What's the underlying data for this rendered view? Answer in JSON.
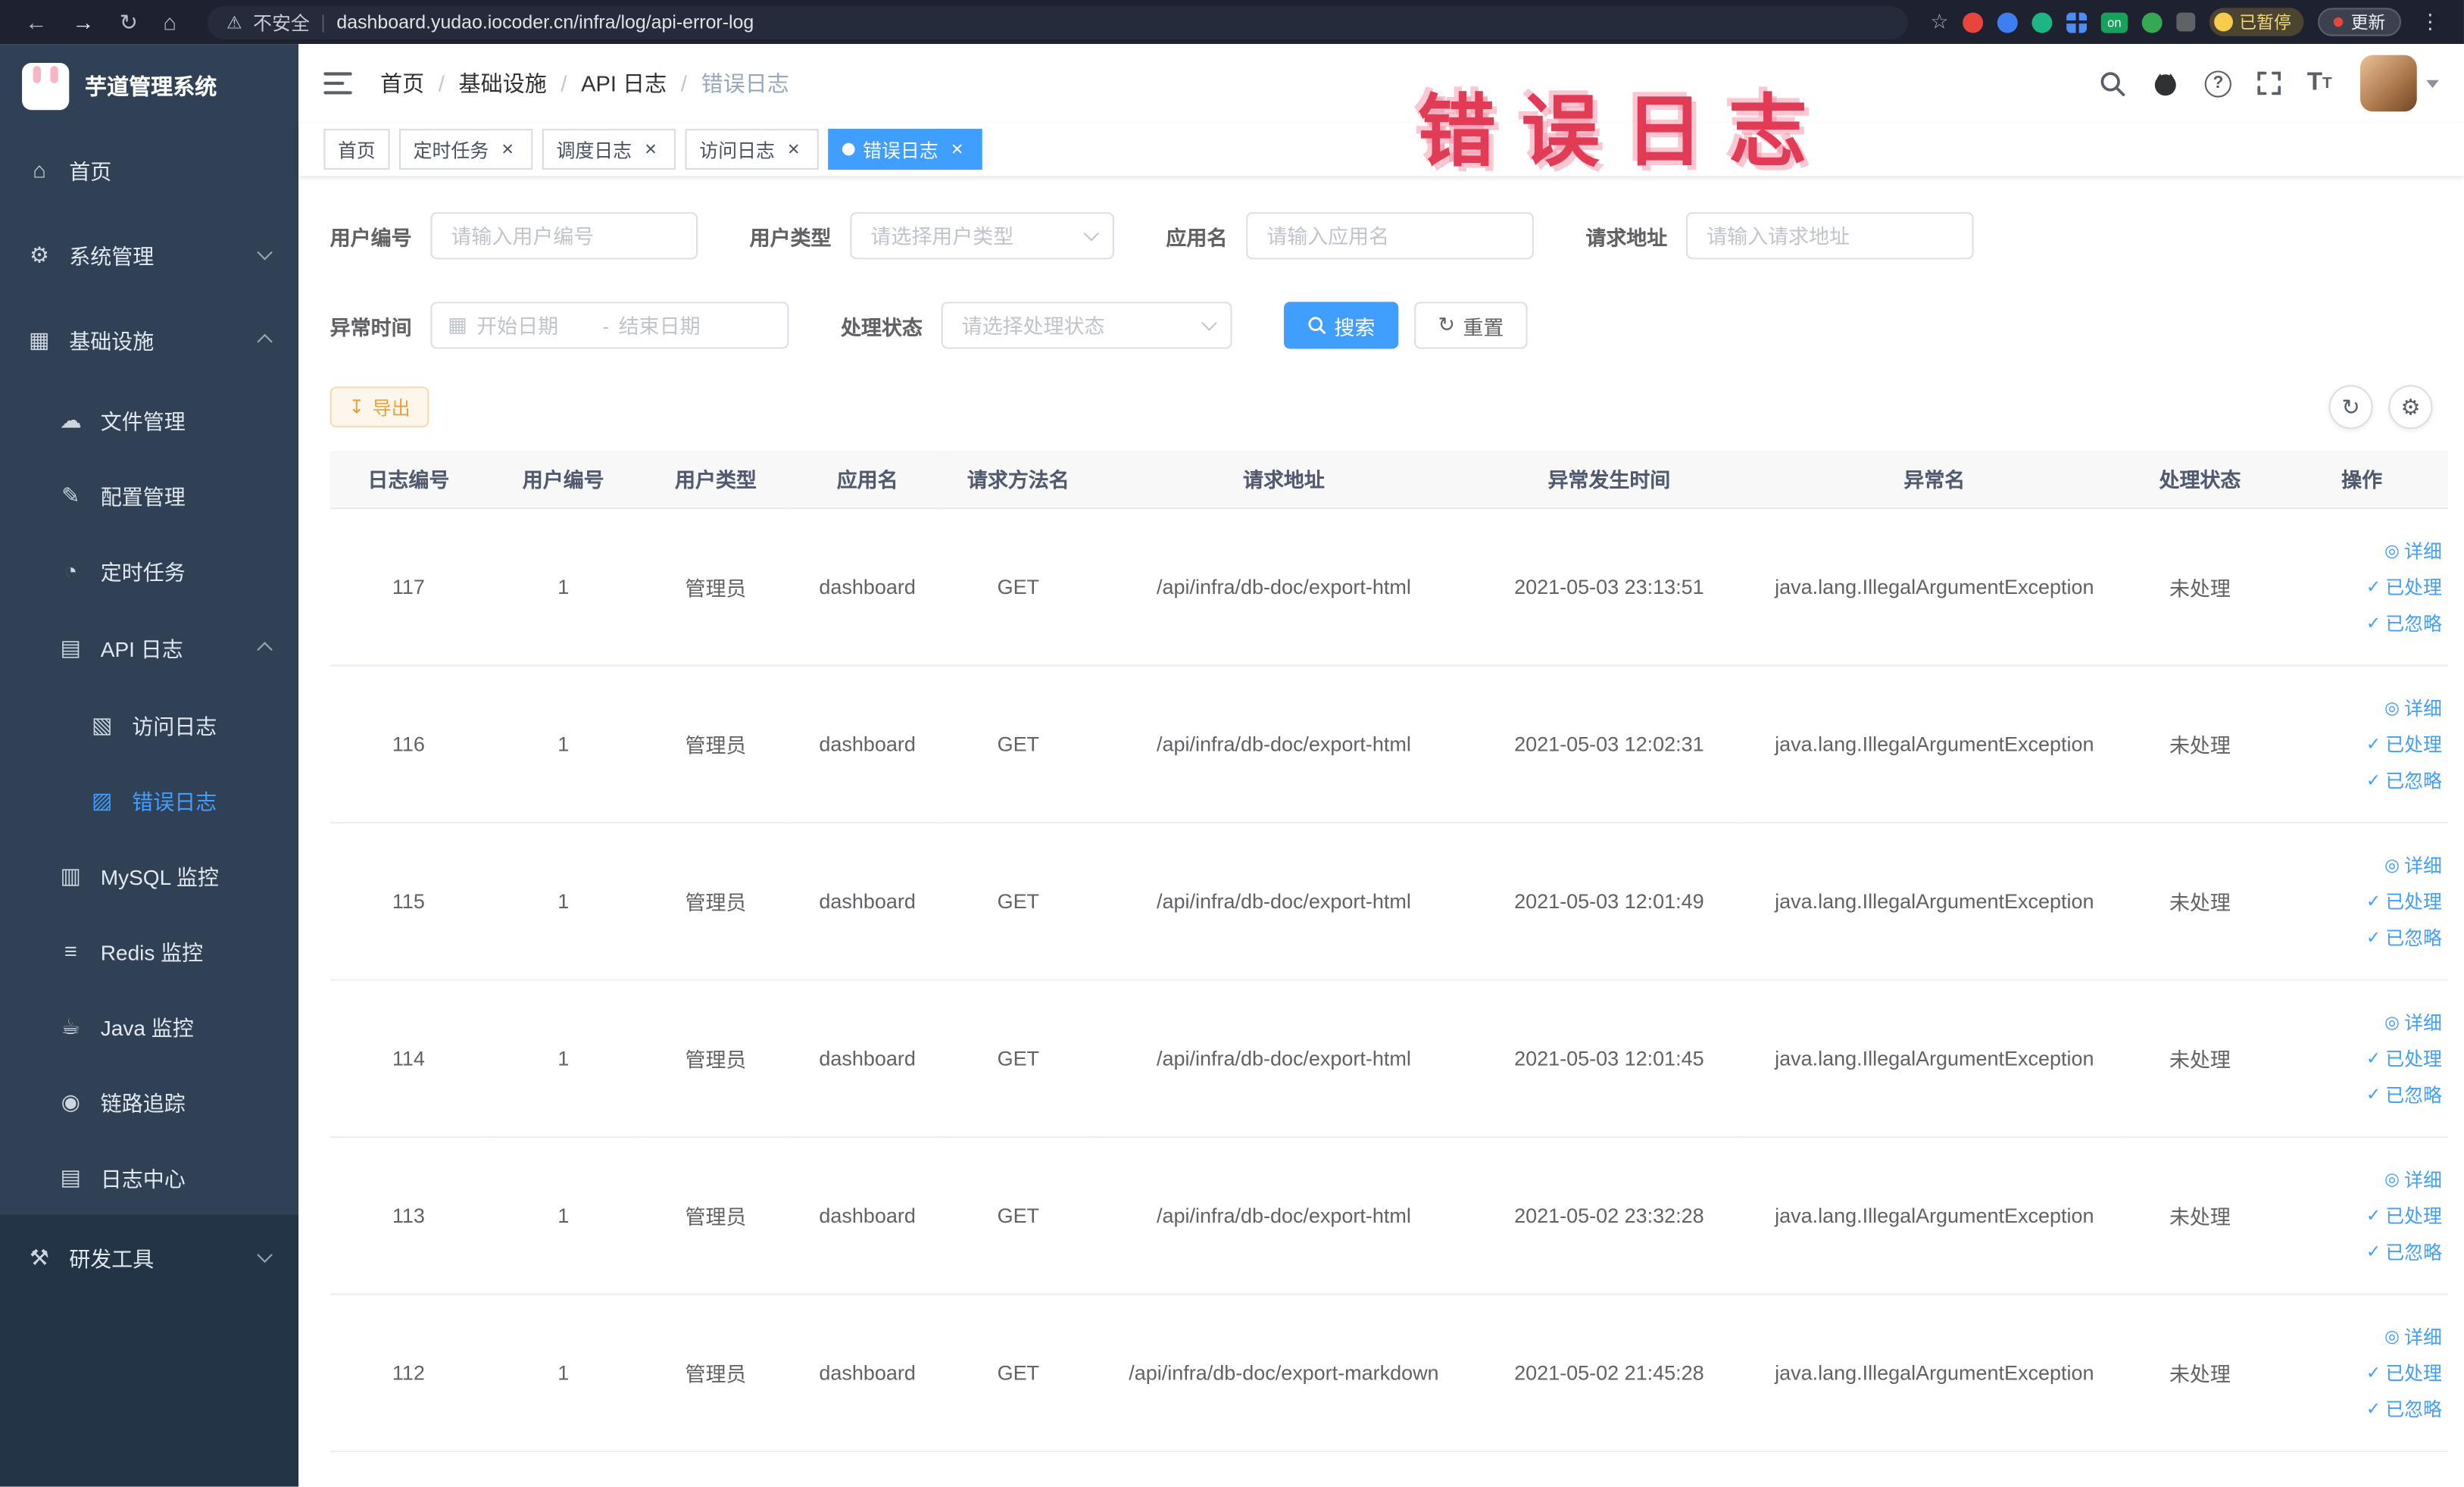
{
  "browser": {
    "security_label": "不安全",
    "url": "dashboard.yudao.iocoder.cn/infra/log/api-error-log",
    "ext_on_label": "on",
    "paused_label": "已暂停",
    "update_label": "更新"
  },
  "icons": {
    "back": "←",
    "forward": "→",
    "reload": "↻",
    "home": "⌂",
    "warning": "⚠",
    "star": "☆",
    "kebab": "⋮",
    "divider": "|",
    "sidebar_home": "⌂",
    "gear": "⚙",
    "infra": "▦",
    "file": "☁",
    "config": "✎",
    "timer": "◔",
    "api_log": "▤",
    "access_log": "▧",
    "error_log": "▨",
    "mysql": "▥",
    "redis": "≡",
    "java": "☕",
    "trace": "◉",
    "log_center": "▤",
    "tools": "⚒",
    "question": "?",
    "calendar": "▦",
    "download": "↧",
    "refresh": "↻",
    "settings": "⚙",
    "eye": "◎",
    "check": "✓",
    "close": "×",
    "font_big": "T",
    "font_small": "T"
  },
  "sidebar": {
    "logo_text": "芋道管理系统",
    "items": [
      "首页",
      "系统管理",
      "基础设施",
      "文件管理",
      "配置管理",
      "定时任务",
      "API 日志",
      "访问日志",
      "错误日志",
      "MySQL 监控",
      "Redis 监控",
      "Java 监控",
      "链路追踪",
      "日志中心",
      "研发工具"
    ]
  },
  "header": {
    "breadcrumb": [
      "首页",
      "基础设施",
      "API 日志",
      "错误日志"
    ],
    "separator": "/"
  },
  "annotation": "错误日志",
  "tabs": [
    {
      "label": "首页",
      "active": false,
      "closable": false
    },
    {
      "label": "定时任务",
      "active": false,
      "closable": true
    },
    {
      "label": "调度日志",
      "active": false,
      "closable": true
    },
    {
      "label": "访问日志",
      "active": false,
      "closable": true
    },
    {
      "label": "错误日志",
      "active": true,
      "closable": true
    }
  ],
  "filters": {
    "user_id": {
      "label": "用户编号",
      "placeholder": "请输入用户编号",
      "value": ""
    },
    "user_type": {
      "label": "用户类型",
      "placeholder": "请选择用户类型",
      "value": ""
    },
    "app_name": {
      "label": "应用名",
      "placeholder": "请输入应用名",
      "value": ""
    },
    "request_url": {
      "label": "请求地址",
      "placeholder": "请输入请求地址",
      "value": ""
    },
    "exception_time": {
      "label": "异常时间",
      "start_placeholder": "开始日期",
      "separator": "-",
      "end_placeholder": "结束日期"
    },
    "process_status": {
      "label": "处理状态",
      "placeholder": "请选择处理状态",
      "value": ""
    },
    "search_label": "搜索",
    "reset_label": "重置"
  },
  "toolbar": {
    "export_label": "导出"
  },
  "table": {
    "columns": [
      "日志编号",
      "用户编号",
      "用户类型",
      "应用名",
      "请求方法名",
      "请求地址",
      "异常发生时间",
      "异常名",
      "处理状态",
      "操作"
    ],
    "rows": [
      {
        "log_id": "117",
        "user_id": "1",
        "user_type": "管理员",
        "app": "dashboard",
        "method": "GET",
        "url": "/api/infra/db-doc/export-html",
        "time": "2021-05-03 23:13:51",
        "exception": "java.lang.IllegalArgumentException",
        "status": "未处理"
      },
      {
        "log_id": "116",
        "user_id": "1",
        "user_type": "管理员",
        "app": "dashboard",
        "method": "GET",
        "url": "/api/infra/db-doc/export-html",
        "time": "2021-05-03 12:02:31",
        "exception": "java.lang.IllegalArgumentException",
        "status": "未处理"
      },
      {
        "log_id": "115",
        "user_id": "1",
        "user_type": "管理员",
        "app": "dashboard",
        "method": "GET",
        "url": "/api/infra/db-doc/export-html",
        "time": "2021-05-03 12:01:49",
        "exception": "java.lang.IllegalArgumentException",
        "status": "未处理"
      },
      {
        "log_id": "114",
        "user_id": "1",
        "user_type": "管理员",
        "app": "dashboard",
        "method": "GET",
        "url": "/api/infra/db-doc/export-html",
        "time": "2021-05-03 12:01:45",
        "exception": "java.lang.IllegalArgumentException",
        "status": "未处理"
      },
      {
        "log_id": "113",
        "user_id": "1",
        "user_type": "管理员",
        "app": "dashboard",
        "method": "GET",
        "url": "/api/infra/db-doc/export-html",
        "time": "2021-05-02 23:32:28",
        "exception": "java.lang.IllegalArgumentException",
        "status": "未处理"
      },
      {
        "log_id": "112",
        "user_id": "1",
        "user_type": "管理员",
        "app": "dashboard",
        "method": "GET",
        "url": "/api/infra/db-doc/export-markdown",
        "time": "2021-05-02 21:45:28",
        "exception": "java.lang.IllegalArgumentException",
        "status": "未处理"
      }
    ]
  },
  "row_actions": {
    "detail": "详细",
    "processed": "已处理",
    "ignored": "已忽略"
  }
}
